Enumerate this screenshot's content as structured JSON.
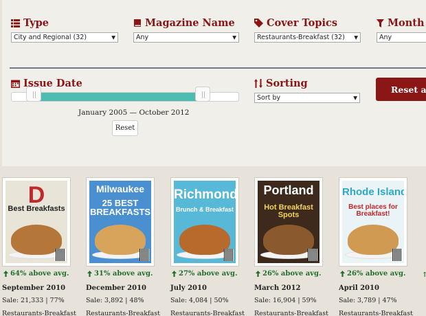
{
  "filters": {
    "type": {
      "label": "Type",
      "value": "City and Regional (32)"
    },
    "magazine": {
      "label": "Magazine Name",
      "value": "Any"
    },
    "topics": {
      "label": "Cover Topics",
      "value": "Restaurants-Breakfast (32)"
    },
    "month": {
      "label": "Month",
      "value": "Any"
    },
    "issue_date": {
      "label": "Issue Date",
      "range_text": "January 2005 — October 2012",
      "reset_label": "Reset",
      "range_start": 0.1,
      "range_end": 0.84
    },
    "sorting": {
      "label": "Sorting",
      "value": "Sort by"
    },
    "reset_all_label": "Reset all"
  },
  "icons": {
    "type": "list-icon",
    "magazine": "book-icon",
    "topics": "tag-icon",
    "month": "filter-icon",
    "issue_date": "calendar-icon",
    "sorting": "sort-icon",
    "above": "arrow-up-icon"
  },
  "colors": {
    "accent": "#8b1414",
    "range": "#4dbdb0",
    "above": "#1f6f2a"
  },
  "results": [
    {
      "mast": "D",
      "headline": "Best Breakfasts",
      "above": "64% above avg.",
      "date": "September 2010",
      "sale": "Sale: 21,333 | 77%",
      "topic": "Restaurants-Breakfast"
    },
    {
      "mast": "Milwaukee",
      "headline": "25 BEST BREAKFASTS",
      "above": "31% above avg.",
      "date": "December 2010",
      "sale": "Sale: 3,892 | 48%",
      "topic": "Restaurants-Breakfast"
    },
    {
      "mast": "Richmond",
      "headline": "Brunch & Breakfast",
      "above": "27% above avg.",
      "date": "July 2010",
      "sale": "Sale: 4,084 | 50%",
      "topic": "Restaurants-Breakfast"
    },
    {
      "mast": "Portland",
      "headline": "Hot Breakfast Spots",
      "above": "26% above avg.",
      "date": "March 2012",
      "sale": "Sale: 16,904 | 59%",
      "topic": "Restaurants-Breakfast"
    },
    {
      "mast": "Rhode Island",
      "headline": "Best places for Breakfast!",
      "above": "26% above avg.",
      "date": "April 2010",
      "sale": "Sale: 3,789 | 47%",
      "topic": "Restaurants-Breakfast"
    }
  ]
}
